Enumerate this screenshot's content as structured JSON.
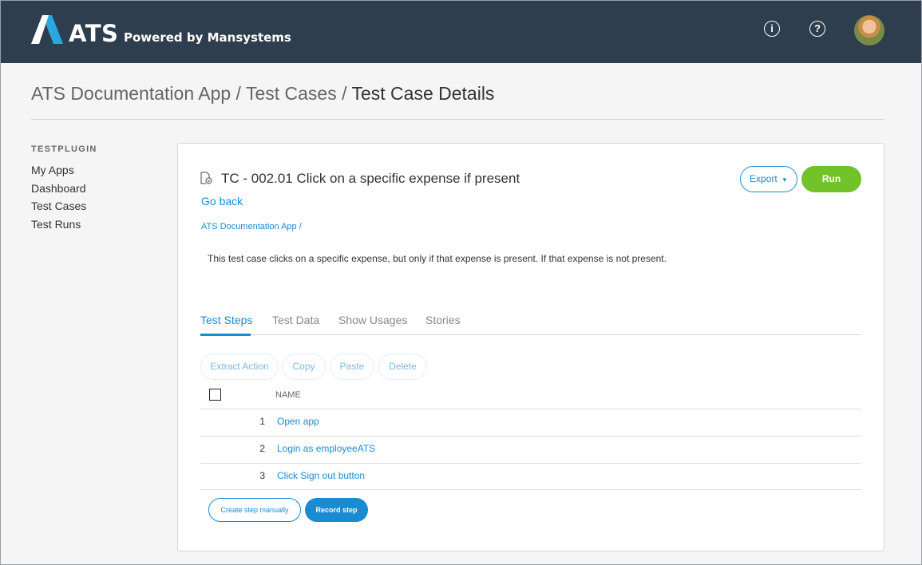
{
  "header": {
    "brand": "ATS",
    "tagline": "Powered by Mansystems",
    "info_icon": "info-circle-icon",
    "help_icon": "question-circle-icon",
    "avatar": "user-avatar",
    "bg_color": "#2e3e4e"
  },
  "breadcrumb": {
    "part1": "ATS Documentation App",
    "sep1": " / ",
    "part2": "Test Cases",
    "sep2": " / ",
    "current": "Test Case Details"
  },
  "sidebar": {
    "title": "TESTPLUGIN",
    "items": [
      {
        "label": "My Apps"
      },
      {
        "label": "Dashboard"
      },
      {
        "label": "Test Cases"
      },
      {
        "label": "Test Runs"
      }
    ]
  },
  "testcase": {
    "title": "TC - 002.01 Click on a specific expense if present",
    "go_back": "Go back",
    "app_link": "ATS Documentation App /",
    "description": "This test case clicks on a specific expense, but only if that expense is present. If that expense is not present.",
    "export_label": "Export",
    "run_label": "Run"
  },
  "tabs": [
    {
      "label": "Test Steps",
      "active": true
    },
    {
      "label": "Test Data",
      "active": false
    },
    {
      "label": "Show Usages",
      "active": false
    },
    {
      "label": "Stories",
      "active": false
    }
  ],
  "toolbar": {
    "extract": "Extract Action",
    "copy": "Copy",
    "paste": "Paste",
    "delete": "Delete"
  },
  "table": {
    "column_name": "NAME",
    "rows": [
      {
        "num": "1",
        "name": "Open app"
      },
      {
        "num": "2",
        "name": "Login as employeeATS"
      },
      {
        "num": "3",
        "name": "Click Sign out button"
      }
    ]
  },
  "actions": {
    "create_manual": "Create step manually",
    "record": "Record step"
  },
  "colors": {
    "accent": "#1a8bd1",
    "run": "#72c22a"
  }
}
